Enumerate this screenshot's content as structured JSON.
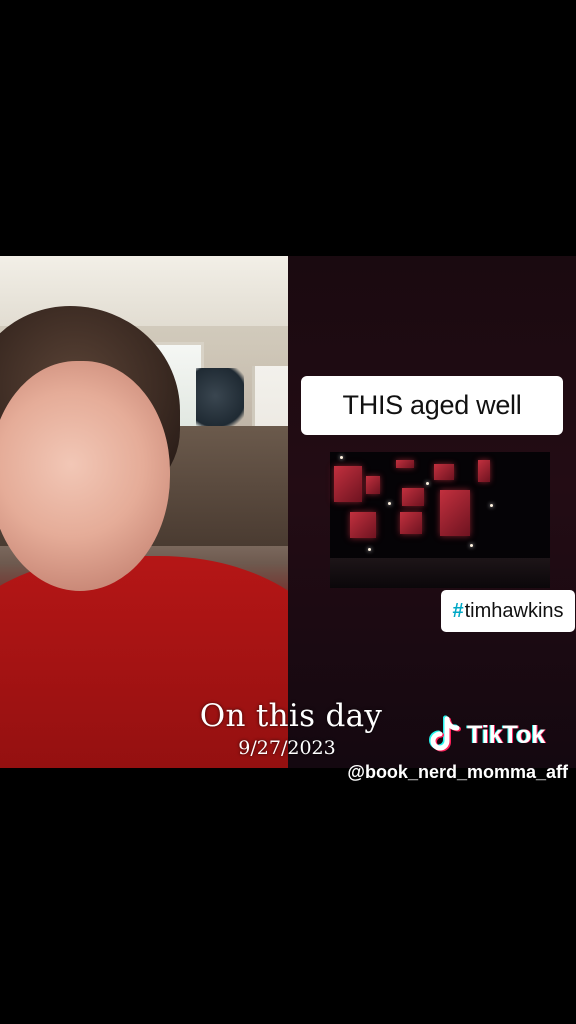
{
  "video": {
    "caption": "THIS aged well",
    "hashtag_symbol": "#",
    "hashtag_text": "timhawkins"
  },
  "overlay": {
    "title": "On this day",
    "date": "9/27/2023"
  },
  "watermark": {
    "brand": "TikTok",
    "handle": "@book_nerd_momma_aff",
    "icon": "tiktok-note-icon"
  },
  "colors": {
    "background": "#000000",
    "caption_bg": "#ffffff",
    "hashtag_accent": "#00a8c6",
    "tiktok_pink": "#ff1f5a",
    "tiktok_cyan": "#25f4ee"
  }
}
